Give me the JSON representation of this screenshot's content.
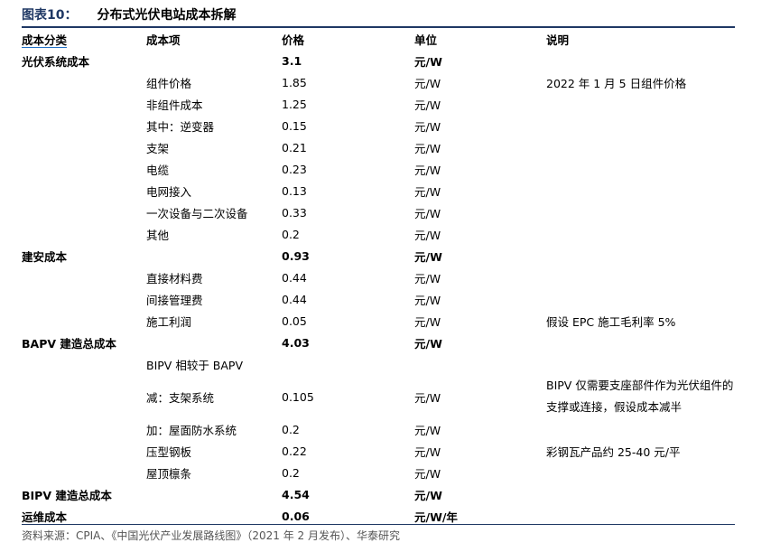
{
  "figure": {
    "label": "图表10：",
    "title": "分布式光伏电站成本拆解"
  },
  "columns": [
    "成本分类",
    "成本项",
    "价格",
    "单位",
    "说明"
  ],
  "rows": [
    {
      "category": "光伏系统成本",
      "item": "",
      "price": "3.1",
      "unit": "元/W",
      "note": "",
      "bold": true
    },
    {
      "category": "",
      "item": "组件价格",
      "price": "1.85",
      "unit": "元/W",
      "note": "2022 年 1 月 5 日组件价格",
      "bold": false
    },
    {
      "category": "",
      "item": "非组件成本",
      "price": "1.25",
      "unit": "元/W",
      "note": "",
      "bold": false
    },
    {
      "category": "",
      "item": "其中：逆变器",
      "price": "0.15",
      "unit": "元/W",
      "note": "",
      "bold": false
    },
    {
      "category": "",
      "item": "支架",
      "price": "0.21",
      "unit": "元/W",
      "note": "",
      "bold": false
    },
    {
      "category": "",
      "item": "电缆",
      "price": "0.23",
      "unit": "元/W",
      "note": "",
      "bold": false
    },
    {
      "category": "",
      "item": "电网接入",
      "price": "0.13",
      "unit": "元/W",
      "note": "",
      "bold": false
    },
    {
      "category": "",
      "item": "一次设备与二次设备",
      "price": "0.33",
      "unit": "元/W",
      "note": "",
      "bold": false
    },
    {
      "category": "",
      "item": "其他",
      "price": "0.2",
      "unit": "元/W",
      "note": "",
      "bold": false
    },
    {
      "category": "建安成本",
      "item": "",
      "price": "0.93",
      "unit": "元/W",
      "note": "",
      "bold": true
    },
    {
      "category": "",
      "item": "直接材料费",
      "price": "0.44",
      "unit": "元/W",
      "note": "",
      "bold": false
    },
    {
      "category": "",
      "item": "间接管理费",
      "price": "0.44",
      "unit": "元/W",
      "note": "",
      "bold": false
    },
    {
      "category": "",
      "item": "施工利润",
      "price": "0.05",
      "unit": "元/W",
      "note": "假设 EPC 施工毛利率 5%",
      "bold": false
    },
    {
      "category": "BAPV 建造总成本",
      "item": "",
      "price": "4.03",
      "unit": "元/W",
      "note": "",
      "bold": true
    },
    {
      "category": "",
      "item": "BIPV 相较于 BAPV",
      "price": "",
      "unit": "",
      "note": "",
      "bold": false
    },
    {
      "category": "",
      "item": "减：支架系统",
      "price": "0.105",
      "unit": "元/W",
      "note": "BIPV 仅需要支座部件作为光伏组件的支撑或连接，假设成本减半",
      "bold": false,
      "wrap": true
    },
    {
      "category": "",
      "item": "加：屋面防水系统",
      "price": "0.2",
      "unit": "元/W",
      "note": "",
      "bold": false
    },
    {
      "category": "",
      "item": "压型钢板",
      "price": "0.22",
      "unit": "元/W",
      "note": "彩钢瓦产品约 25-40 元/平",
      "bold": false
    },
    {
      "category": "",
      "item": "屋顶檩条",
      "price": "0.2",
      "unit": "元/W",
      "note": "",
      "bold": false
    },
    {
      "category": "BIPV 建造总成本",
      "item": "",
      "price": "4.54",
      "unit": "元/W",
      "note": "",
      "bold": true
    },
    {
      "category": "运维成本",
      "item": "",
      "price": "0.06",
      "unit": "元/W/年",
      "note": "",
      "bold": true
    }
  ],
  "source": "资料来源：CPIA、《中国光伏产业发展路线图》（2021 年 2 月发布）、华泰研究"
}
